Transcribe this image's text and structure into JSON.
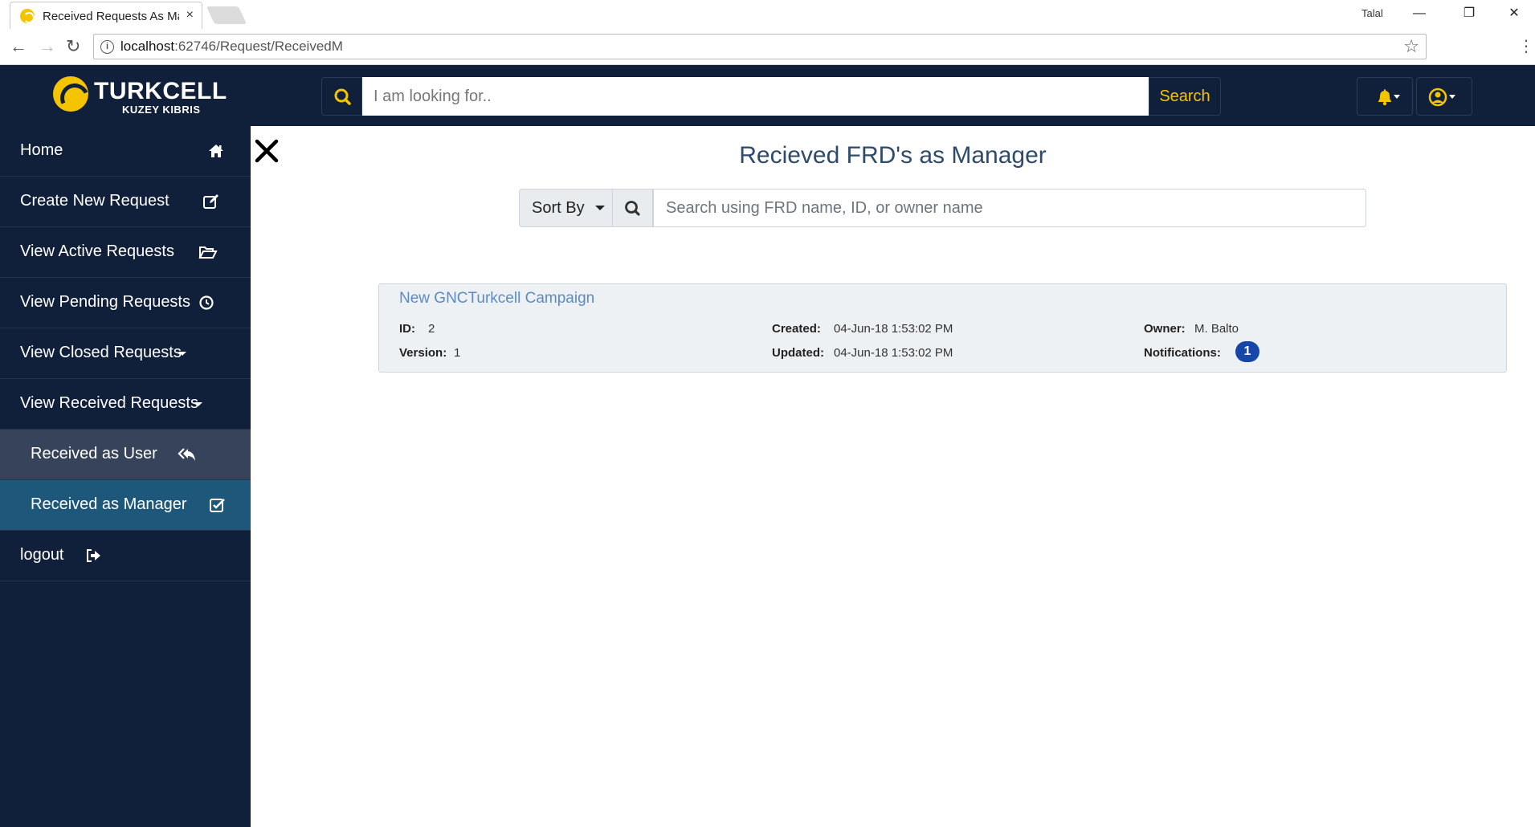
{
  "browser": {
    "tab_title": "Received Requests As Ma",
    "tab_close": "×",
    "profile": "Talal",
    "url_host": "localhost",
    "url_path": ":62746/Request/ReceivedM",
    "window_controls": {
      "minimize": "—",
      "restore": "❐",
      "close": "✕"
    }
  },
  "header": {
    "brand": "TURKCELL",
    "brand_sub": "KUZEY KIBRIS",
    "search_placeholder": "I am looking for..",
    "search_button": "Search",
    "icons": [
      "search-icon",
      "bell-icon",
      "user-circle-icon"
    ],
    "accent_color": "#f5c400"
  },
  "sidebar": {
    "items": [
      {
        "label": "Home",
        "icon": "home-icon"
      },
      {
        "label": "Create New Request",
        "icon": "edit-icon"
      },
      {
        "label": "View Active Requests",
        "icon": "folder-open-icon"
      },
      {
        "label": "View Pending Requests",
        "icon": "clock-icon"
      },
      {
        "label": "View Closed Requests",
        "icon": "caret-down-icon"
      },
      {
        "label": "View Received Requests",
        "icon": "caret-down-icon"
      },
      {
        "label": "Received as User",
        "icon": "reply-all-icon"
      },
      {
        "label": "Received as Manager",
        "icon": "check-square-icon",
        "active": true
      },
      {
        "label": "logout",
        "icon": "sign-out-icon"
      }
    ],
    "background": "#11203a",
    "active_color": "#1d5779"
  },
  "main": {
    "title": "Recieved FRD's as Manager",
    "sort_label": "Sort By",
    "filter_placeholder": "Search using FRD name, ID, or owner name",
    "requests": [
      {
        "name": "New GNCTurkcell Campaign",
        "id_label": "ID:",
        "id": "2",
        "version_label": "Version:",
        "version": "1",
        "created_label": "Created:",
        "created": "04-Jun-18 1:53:02 PM",
        "updated_label": "Updated:",
        "updated": "04-Jun-18 1:53:02 PM",
        "owner_label": "Owner:",
        "owner": "M. Balto",
        "notifications_label": "Notifications:",
        "notifications": "1"
      }
    ]
  }
}
